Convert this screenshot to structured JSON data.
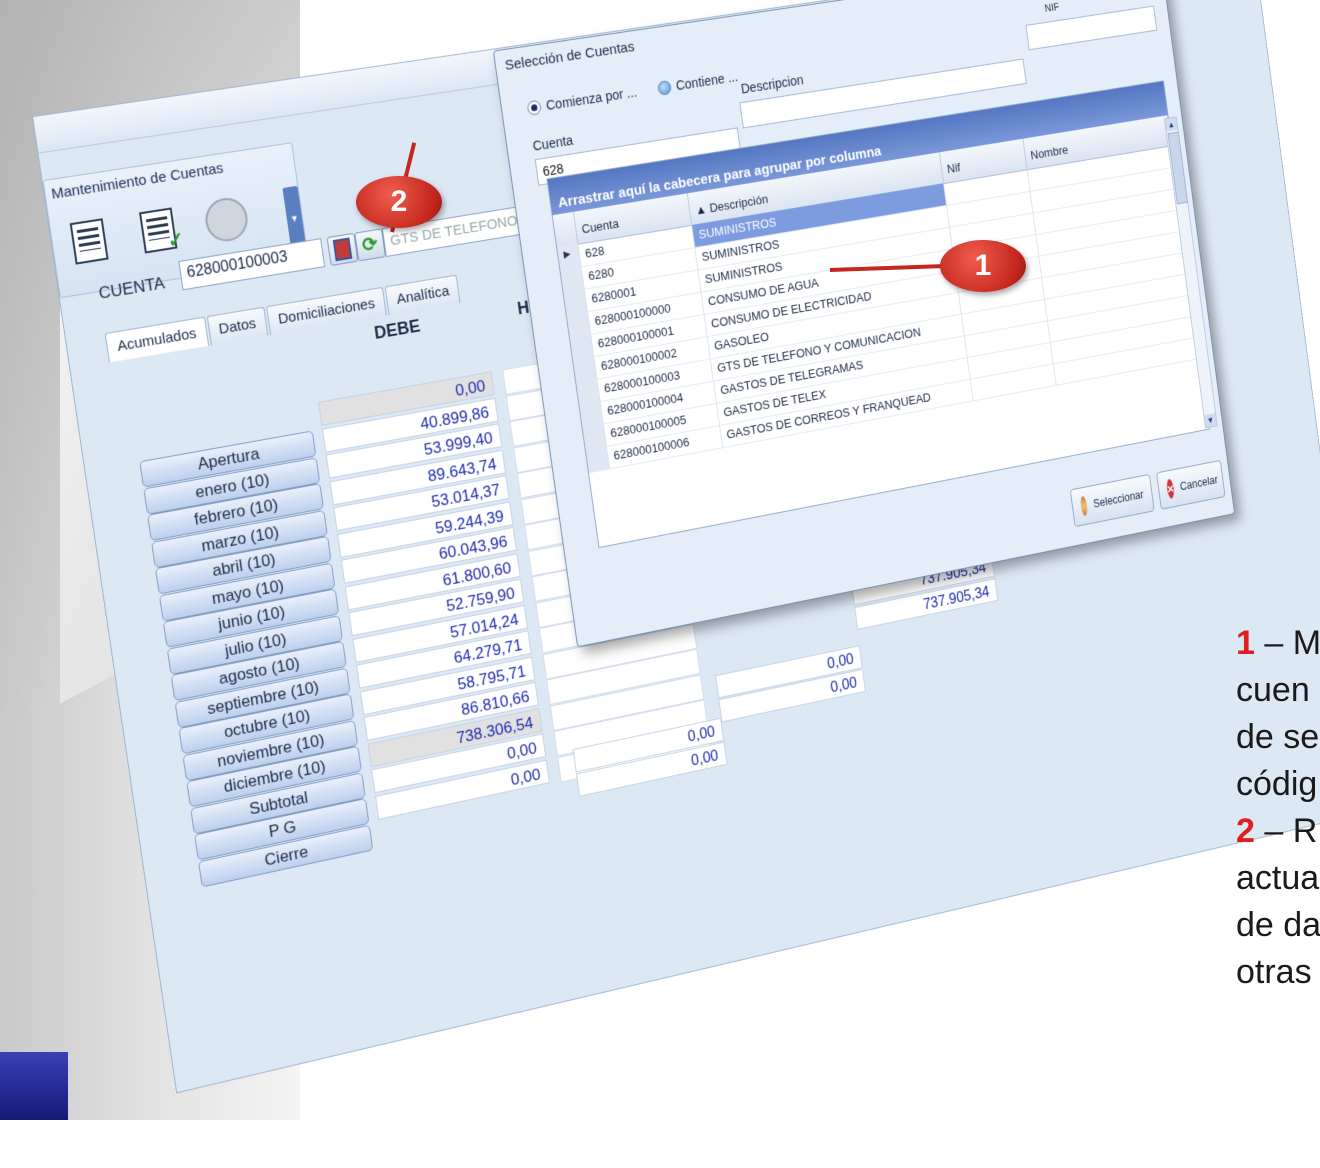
{
  "main_window": {
    "title": "Mantenimiento de Cuentas",
    "cuenta_label": "CUENTA",
    "cuenta_value": "628000100003",
    "description_value": "GTS DE TELEFONO Y COMUNICACION",
    "tabs": [
      "Acumulados",
      "Datos",
      "Domiciliaciones",
      "Analítica"
    ],
    "active_tab": "Acumulados",
    "columns": {
      "debe": "DEBE",
      "haber": "HABER"
    },
    "rows": [
      {
        "label": "Apertura",
        "debe": "0,00",
        "gray": true
      },
      {
        "label": "enero (10)",
        "debe": "40.899,86"
      },
      {
        "label": "febrero (10)",
        "debe": "53.999,40"
      },
      {
        "label": "marzo (10)",
        "debe": "89.643,74"
      },
      {
        "label": "abril (10)",
        "debe": "53.014,37"
      },
      {
        "label": "mayo (10)",
        "debe": "59.244,39"
      },
      {
        "label": "junio (10)",
        "debe": "60.043,96"
      },
      {
        "label": "julio (10)",
        "debe": "61.800,60"
      },
      {
        "label": "agosto (10)",
        "debe": "52.759,90"
      },
      {
        "label": "septiembre (10)",
        "debe": "57.014,24"
      },
      {
        "label": "octubre (10)",
        "debe": "64.279,71"
      },
      {
        "label": "noviembre (10)",
        "debe": "58.795,71"
      },
      {
        "label": "diciembre (10)",
        "debe": "86.810,66"
      },
      {
        "label": "Subtotal",
        "debe": "738.306,54",
        "gray": true
      },
      {
        "label": "P G",
        "debe": "0,00"
      },
      {
        "label": "Cierre",
        "debe": "0,00"
      }
    ],
    "side_values": [
      "737.905,34",
      "737.905,34",
      "0,00",
      "0,00",
      "0,00",
      "0,00"
    ]
  },
  "dialog": {
    "title": "Selección de Cuentas",
    "radio_starts": "Comienza por ...",
    "radio_contains": "Contiene ...",
    "cuenta_label": "Cuenta",
    "descripcion_label": "Descripcion",
    "nif_label": "NIF",
    "cuenta_value": "628",
    "group_hint": "Arrastrar aquí la cabecera para agrupar por columna",
    "headers": {
      "cuenta": "Cuenta",
      "descripcion": "Descripción",
      "nif": "Nif",
      "nombre": "Nombre"
    },
    "rows": [
      {
        "cuenta": "628",
        "descripcion": "SUMINISTROS",
        "selected": true
      },
      {
        "cuenta": "6280",
        "descripcion": "SUMINISTROS"
      },
      {
        "cuenta": "6280001",
        "descripcion": "SUMINISTROS"
      },
      {
        "cuenta": "628000100000",
        "descripcion": "CONSUMO DE AGUA"
      },
      {
        "cuenta": "628000100001",
        "descripcion": "CONSUMO DE ELECTRICIDAD"
      },
      {
        "cuenta": "628000100002",
        "descripcion": "GASOLEO"
      },
      {
        "cuenta": "628000100003",
        "descripcion": "GTS DE TELEFONO Y COMUNICACION"
      },
      {
        "cuenta": "628000100004",
        "descripcion": "GASTOS DE TELEGRAMAS"
      },
      {
        "cuenta": "628000100005",
        "descripcion": "GASTOS DE TELEX"
      },
      {
        "cuenta": "628000100006",
        "descripcion": "GASTOS DE CORREOS Y FRANQUEAD"
      }
    ],
    "select_button": "Seleccionar",
    "cancel_button": "Cancelar"
  },
  "callouts": {
    "badge1": "1",
    "badge2": "2"
  },
  "note": {
    "num1": "1",
    "line1": " – M",
    "line2": "cuen",
    "line3": "de se",
    "line4": "códig",
    "num2": "2",
    "line5": " – R",
    "line6": "actua",
    "line7": "de da",
    "line8": "otras"
  },
  "colors": {
    "accent": "#c4271d",
    "selection": "#7d9ce0",
    "value_text": "#1e2bb0"
  }
}
